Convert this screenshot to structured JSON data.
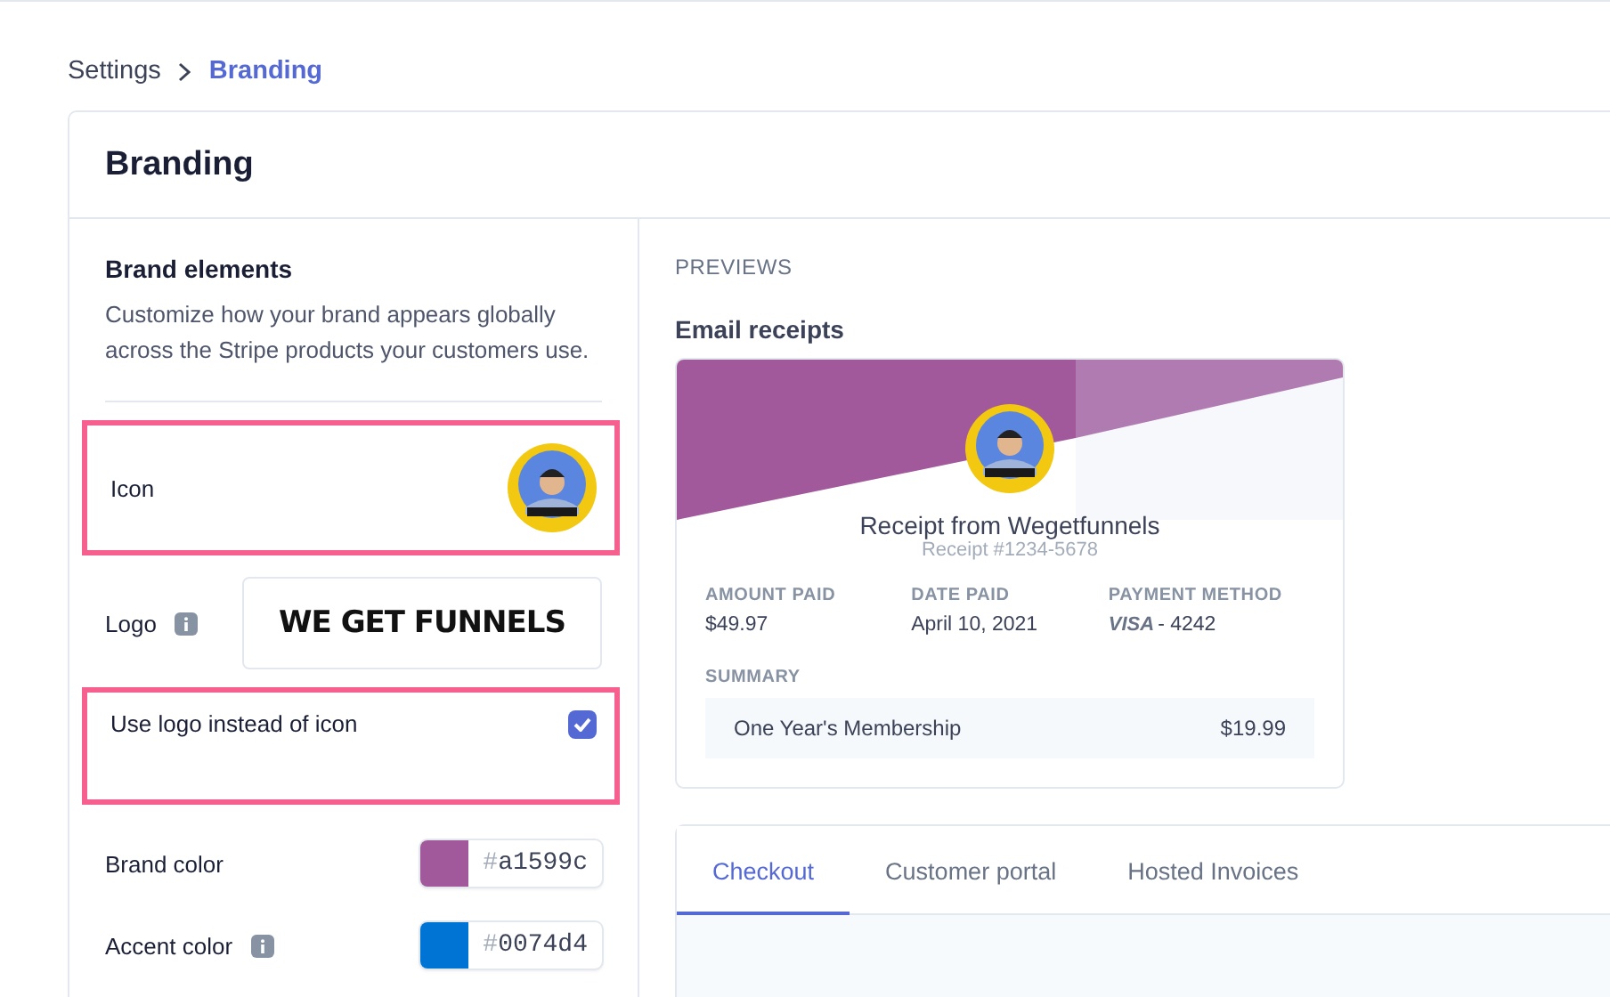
{
  "breadcrumb": [
    {
      "label": "Settings",
      "current": false
    },
    {
      "label": "Branding",
      "current": true
    }
  ],
  "card_title": "Branding",
  "brand_elements": {
    "title": "Brand elements",
    "description": "Customize how your brand appears globally across the Stripe products your customers use.",
    "rows": [
      {
        "kind": "icon",
        "label": "Icon",
        "highlighted": true
      },
      {
        "kind": "logo",
        "label": "Logo",
        "info": true,
        "logo_text": "WE GET FUNNELS",
        "highlighted": false
      },
      {
        "kind": "checkbox",
        "label": "Use logo instead of icon",
        "checked": true,
        "highlighted": true
      },
      {
        "kind": "color",
        "label": "Brand color",
        "info": false,
        "color": "#a1599c",
        "hash": "#",
        "value": "a1599c",
        "highlighted": false
      },
      {
        "kind": "color",
        "label": "Accent color",
        "info": true,
        "color": "#0074d4",
        "hash": "#",
        "value": "0074d4",
        "highlighted": false
      }
    ]
  },
  "previews": {
    "heading": "PREVIEWS",
    "email_title": "Email receipts",
    "receipt": {
      "title": "Receipt from Wegetfunnels",
      "number": "Receipt #1234-5678",
      "fields": [
        {
          "kind": "text",
          "label": "AMOUNT PAID",
          "value": "$49.97"
        },
        {
          "kind": "text",
          "label": "DATE PAID",
          "value": "April 10, 2021"
        },
        {
          "kind": "card",
          "label": "PAYMENT METHOD",
          "brand": "VISA",
          "value": "- 4242"
        }
      ],
      "summary_label": "SUMMARY",
      "summary_items": [
        {
          "name": "One Year's Membership",
          "amount": "$19.99"
        }
      ]
    },
    "tabs": [
      {
        "label": "Checkout",
        "selected": true
      },
      {
        "label": "Customer portal",
        "selected": false
      },
      {
        "label": "Hosted Invoices",
        "selected": false
      }
    ]
  }
}
